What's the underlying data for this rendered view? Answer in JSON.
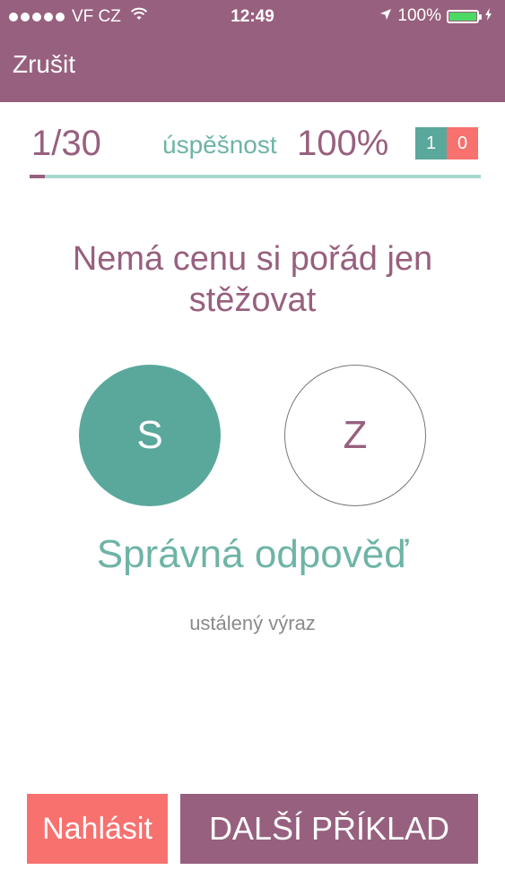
{
  "status_bar": {
    "carrier": "VF CZ",
    "time": "12:49",
    "battery": "100%",
    "battery_level": 1.0,
    "signal_bars": 5
  },
  "nav": {
    "cancel_label": "Zrušit"
  },
  "stats": {
    "counter": "1/30",
    "success_label": "úspěšnost",
    "success_value": "100%",
    "correct_count": "1",
    "wrong_count": "0",
    "progress_fraction": 0.0333
  },
  "question": {
    "text": "Nemá cenu si pořád jen stěžovat"
  },
  "options": [
    {
      "label": "S",
      "state": "selected-correct"
    },
    {
      "label": "Z",
      "state": "unselected"
    }
  ],
  "feedback": {
    "result": "Správná odpověď",
    "explanation": "ustálený výraz"
  },
  "buttons": {
    "report_label": "Nahlásit",
    "next_label": "DALŠÍ PŘÍKLAD"
  },
  "colors": {
    "brand": "#97607e",
    "correct": "#5aa89b",
    "wrong": "#f7716f",
    "battery": "#4cd964"
  },
  "icons": {
    "wifi": "wifi-icon",
    "location": "location-arrow-icon",
    "battery": "battery-icon",
    "charging": "charging-bolt-icon"
  }
}
